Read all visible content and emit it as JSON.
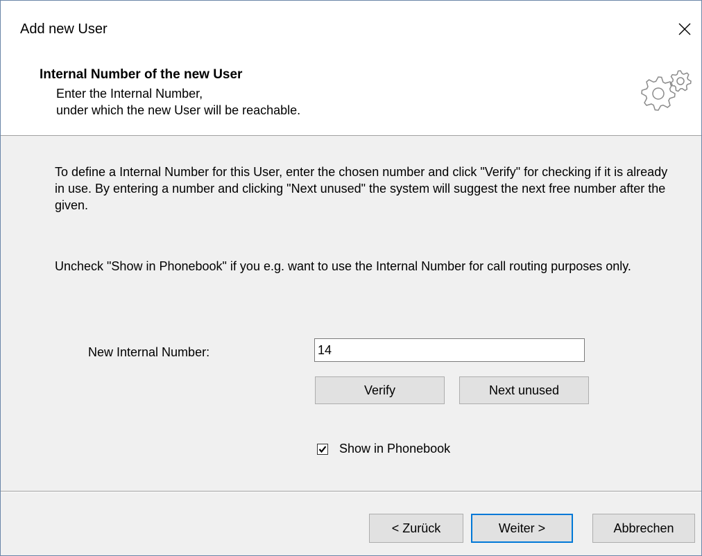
{
  "window": {
    "title": "Add new User",
    "close_icon": "close-icon"
  },
  "header": {
    "title": "Internal Number of the new User",
    "subtitle_line1": "Enter the Internal Number,",
    "subtitle_line2": "under which the new User will be reachable.",
    "icon": "gears-icon"
  },
  "content": {
    "paragraph1": "To define a Internal Number for this User, enter the chosen number and click \"Verify\" for checking if it is already in use. By entering a number and clicking \"Next unused\" the system will suggest the next free number after the given.",
    "paragraph2": "Uncheck \"Show in Phonebook\" if you e.g. want to use the Internal Number for call routing purposes only.",
    "number_label": "New Internal Number:",
    "number_value": "14",
    "verify_label": "Verify",
    "next_unused_label": "Next unused",
    "show_in_phonebook_label": "Show in Phonebook",
    "show_in_phonebook_checked": true
  },
  "footer": {
    "back_label": "< Zurück",
    "next_label": "Weiter >",
    "cancel_label": "Abbrechen"
  },
  "colors": {
    "dialog_bg": "#f0f0f0",
    "header_bg": "#ffffff",
    "button_bg": "#e1e1e1",
    "default_button_border": "#0078d7",
    "window_border": "#6a86a8"
  }
}
